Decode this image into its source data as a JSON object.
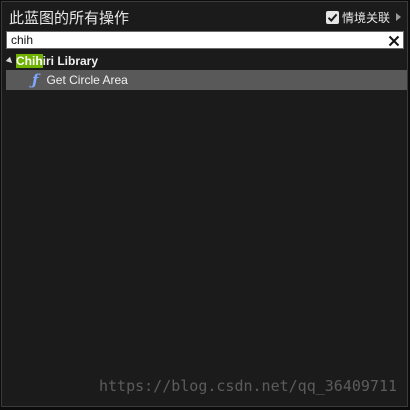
{
  "header": {
    "title": "此蓝图的所有操作",
    "context_sensitive_label": "情境关联",
    "context_sensitive_checked": true
  },
  "search": {
    "value": "chih",
    "placeholder": ""
  },
  "tree": {
    "category": {
      "match": "Chih",
      "rest": "iri Library"
    },
    "items": [
      {
        "label": "Get Circle Area",
        "icon": "function-icon"
      }
    ]
  },
  "watermark": "https://blog.csdn.net/qq_36409711",
  "colors": {
    "panel_bg": "#1b1b1b",
    "highlight": "#6fb300",
    "selected_row": "#595959",
    "function_icon": "#7fa8ff"
  }
}
